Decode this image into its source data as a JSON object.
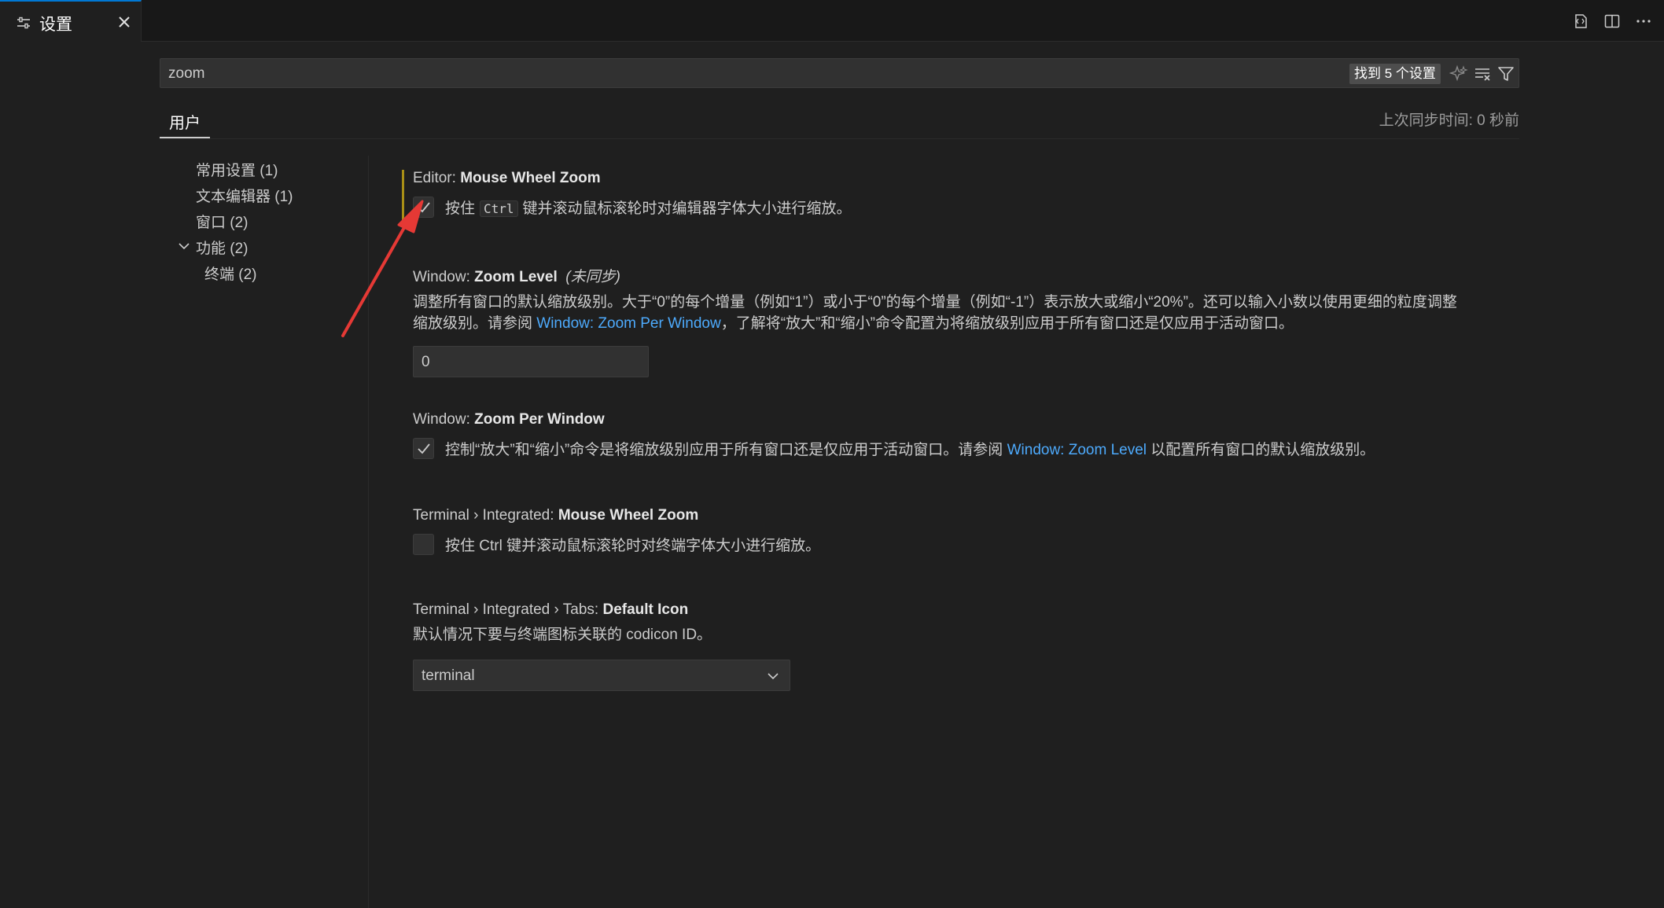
{
  "tab": {
    "label": "设置",
    "icon": "settings-sliders-icon",
    "close_icon": "close-icon"
  },
  "tab_actions": [
    {
      "name": "open-settings-json-icon"
    },
    {
      "name": "split-editor-icon"
    },
    {
      "name": "more-actions-icon"
    }
  ],
  "search": {
    "value": "zoom",
    "results_badge": "找到 5 个设置"
  },
  "scopes": {
    "user_tab": "用户",
    "sync_status": "上次同步时间: 0 秒前"
  },
  "toc": [
    {
      "label": "常用设置 (1)"
    },
    {
      "label": "文本编辑器 (1)"
    },
    {
      "label": "窗口 (2)"
    },
    {
      "label": "功能 (2)",
      "expanded": true
    },
    {
      "label": "终端 (2)",
      "indent": true
    }
  ],
  "settings": {
    "editor_mouse_wheel_zoom": {
      "category": "Editor: ",
      "key": "Mouse Wheel Zoom",
      "checked": true,
      "desc_before": "按住",
      "desc_code": "Ctrl",
      "desc_after": "键并滚动鼠标滚轮时对编辑器字体大小进行缩放。"
    },
    "window_zoom_level": {
      "category": "Window: ",
      "key": "Zoom Level",
      "sync_note": "(未同步)",
      "desc_line1": "调整所有窗口的默认缩放级别。大于“0”的每个增量（例如“1”）或小于“0”的每个增量（例如“-1”）表示放大或缩小“20%”。还可以输入小数以使用更细的粒度调整",
      "desc_line2_before": "缩放级别。请参阅 ",
      "desc_line2_link": "Window: Zoom Per Window",
      "desc_line2_after": "，了解将“放大”和“缩小”命令配置为将缩放级别应用于所有窗口还是仅应用于活动窗口。",
      "value": "0"
    },
    "window_zoom_per_window": {
      "category": "Window: ",
      "key": "Zoom Per Window",
      "checked": true,
      "desc_before": "控制“放大”和“缩小”命令是将缩放级别应用于所有窗口还是仅应用于活动窗口。请参阅 ",
      "desc_link": "Window: Zoom Level",
      "desc_after": " 以配置所有窗口的默认缩放级别。"
    },
    "terminal_mouse_wheel_zoom": {
      "category": "Terminal › Integrated: ",
      "key": "Mouse Wheel Zoom",
      "checked": false,
      "desc": "按住 Ctrl 键并滚动鼠标滚轮时对终端字体大小进行缩放。"
    },
    "terminal_tabs_default_icon": {
      "category": "Terminal › Integrated › Tabs: ",
      "key": "Default Icon",
      "desc": "默认情况下要与终端图标关联的 codicon ID。",
      "value": "terminal"
    }
  },
  "colors": {
    "background": "#1f1f1f",
    "accent": "#0078d4",
    "link": "#4daafc",
    "focus_bar": "#a98f16",
    "annotation_arrow": "#e53935"
  }
}
